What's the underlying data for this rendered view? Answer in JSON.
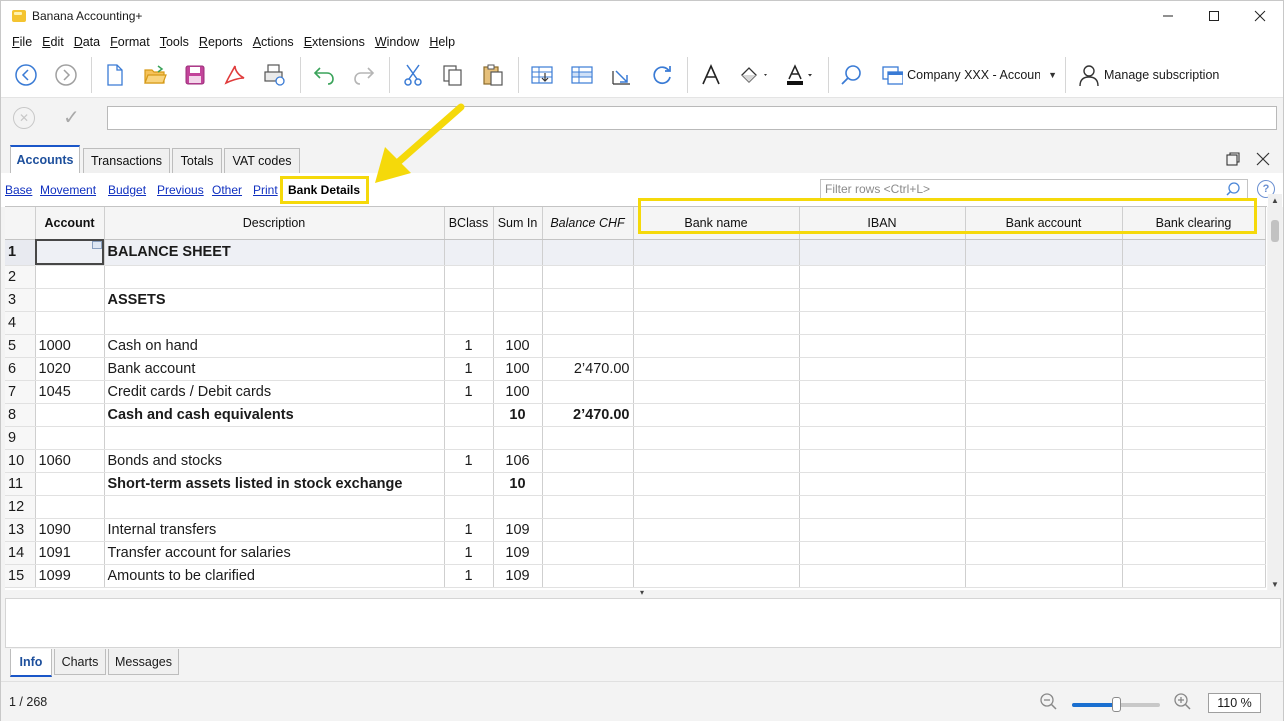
{
  "window": {
    "title": "Banana Accounting+",
    "controls": [
      "minimize",
      "maximize",
      "close"
    ]
  },
  "menu": {
    "items": [
      {
        "label": "File",
        "accel": "F",
        "rest": "ile"
      },
      {
        "label": "Edit",
        "accel": "E",
        "rest": "dit"
      },
      {
        "label": "Data",
        "accel": "D",
        "rest": "ata"
      },
      {
        "label": "Format",
        "accel": "F",
        "rest": "ormat"
      },
      {
        "label": "Tools",
        "accel": "T",
        "rest": "ools"
      },
      {
        "label": "Reports",
        "accel": "R",
        "rest": "eports"
      },
      {
        "label": "Actions",
        "accel": "A",
        "rest": "ctions"
      },
      {
        "label": "Extensions",
        "accel": "E",
        "rest": "xtensions"
      },
      {
        "label": "Window",
        "accel": "W",
        "rest": "indow"
      },
      {
        "label": "Help",
        "accel": "H",
        "rest": "elp"
      }
    ]
  },
  "toolbar": {
    "company_label": "Company XXX - Accoun...",
    "subscription_label": "Manage subscription",
    "accent_color": "#1a6fd0"
  },
  "doc_tabs": [
    {
      "label": "Accounts",
      "active": true
    },
    {
      "label": "Transactions",
      "active": false
    },
    {
      "label": "Totals",
      "active": false
    },
    {
      "label": "VAT codes",
      "active": false
    }
  ],
  "views": {
    "links": [
      "Base",
      "Movement",
      "Budget",
      "Previous",
      "Other",
      "Print"
    ],
    "active": "Bank Details"
  },
  "filter": {
    "placeholder": "Filter rows <Ctrl+L>"
  },
  "table": {
    "columns": [
      "Account",
      "Description",
      "BClass",
      "Sum In",
      "Balance CHF",
      "Bank name",
      "IBAN",
      "Bank account",
      "Bank clearing"
    ],
    "rows": [
      {
        "n": "1",
        "account": "",
        "desc": "BALANCE SHEET",
        "bclass": "",
        "sumin": "",
        "balance": "",
        "style": "big"
      },
      {
        "n": "2",
        "account": "",
        "desc": "",
        "bclass": "",
        "sumin": "",
        "balance": "",
        "style": ""
      },
      {
        "n": "3",
        "account": "",
        "desc": "ASSETS",
        "bclass": "",
        "sumin": "",
        "balance": "",
        "style": "big"
      },
      {
        "n": "4",
        "account": "",
        "desc": "",
        "bclass": "",
        "sumin": "",
        "balance": "",
        "style": ""
      },
      {
        "n": "5",
        "account": "1000",
        "desc": "Cash on hand",
        "bclass": "1",
        "sumin": "100",
        "balance": "",
        "style": ""
      },
      {
        "n": "6",
        "account": "1020",
        "desc": "Bank account",
        "bclass": "1",
        "sumin": "100",
        "balance": "2’470.00",
        "style": ""
      },
      {
        "n": "7",
        "account": "1045",
        "desc": "Credit cards / Debit cards",
        "bclass": "1",
        "sumin": "100",
        "balance": "",
        "style": ""
      },
      {
        "n": "8",
        "account": "",
        "desc": "Cash and cash equivalents",
        "bclass": "",
        "sumin": "10",
        "balance": "2’470.00",
        "style": "bold"
      },
      {
        "n": "9",
        "account": "",
        "desc": "",
        "bclass": "",
        "sumin": "",
        "balance": "",
        "style": ""
      },
      {
        "n": "10",
        "account": "1060",
        "desc": "Bonds and stocks",
        "bclass": "1",
        "sumin": "106",
        "balance": "",
        "style": ""
      },
      {
        "n": "11",
        "account": "",
        "desc": "Short-term assets listed in stock exchange",
        "bclass": "",
        "sumin": "10",
        "balance": "",
        "style": "bold"
      },
      {
        "n": "12",
        "account": "",
        "desc": "",
        "bclass": "",
        "sumin": "",
        "balance": "",
        "style": ""
      },
      {
        "n": "13",
        "account": "1090",
        "desc": "Internal transfers",
        "bclass": "1",
        "sumin": "109",
        "balance": "",
        "style": ""
      },
      {
        "n": "14",
        "account": "1091",
        "desc": "Transfer account for salaries",
        "bclass": "1",
        "sumin": "109",
        "balance": "",
        "style": ""
      },
      {
        "n": "15",
        "account": "1099",
        "desc": "Amounts to be clarified",
        "bclass": "1",
        "sumin": "109",
        "balance": "",
        "style": ""
      }
    ]
  },
  "bottom_tabs": [
    {
      "label": "Info",
      "active": true
    },
    {
      "label": "Charts",
      "active": false
    },
    {
      "label": "Messages",
      "active": false
    }
  ],
  "status": {
    "position": "1 / 268",
    "zoom": "110 %",
    "zoom_level_fraction": 0.5
  },
  "annotation": {
    "highlight_color": "#f5d90a"
  }
}
